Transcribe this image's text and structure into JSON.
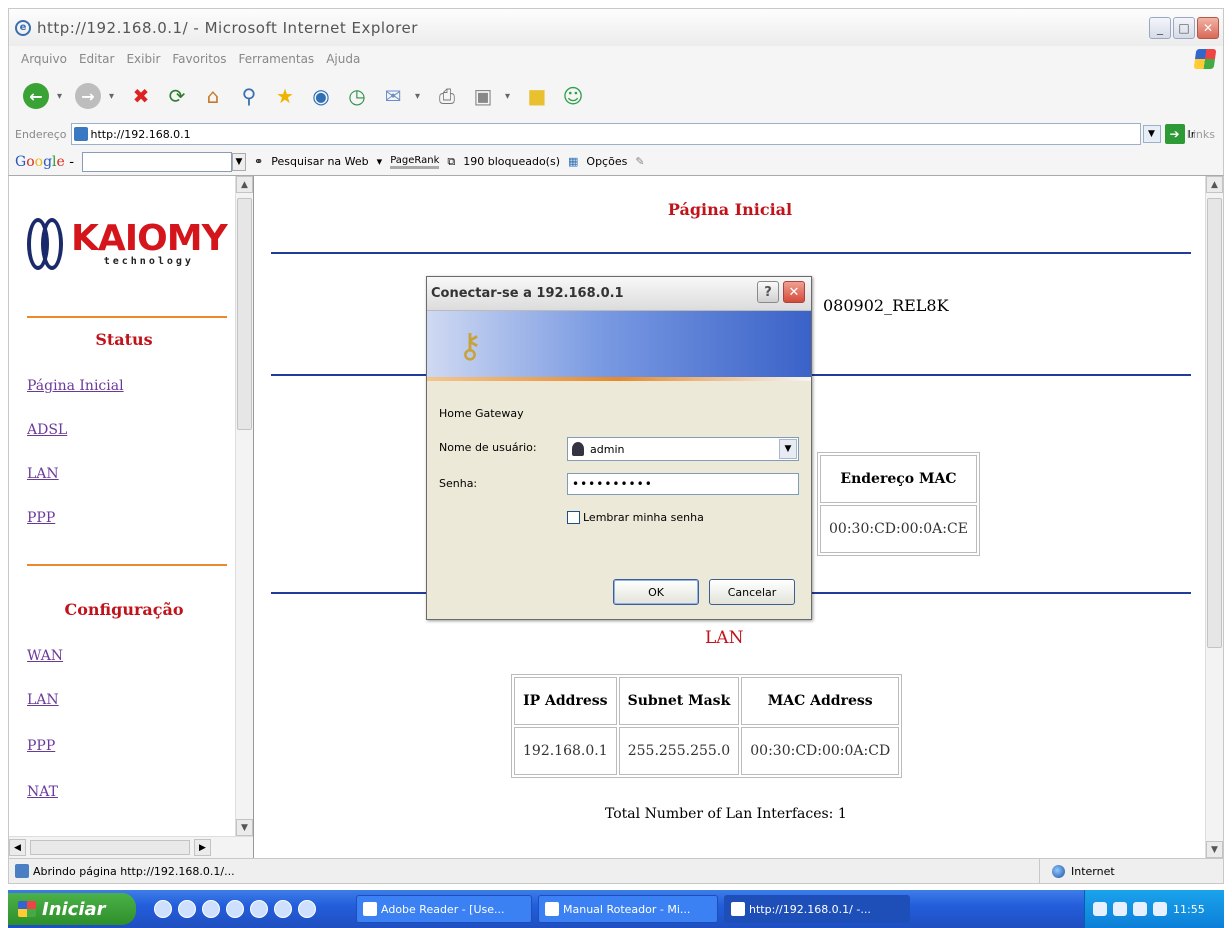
{
  "window": {
    "title": "http://192.168.0.1/ - Microsoft Internet Explorer",
    "minimize_glyph": "_",
    "maximize_glyph": "□",
    "close_glyph": "✕"
  },
  "menu": [
    "Arquivo",
    "Editar",
    "Exibir",
    "Favoritos",
    "Ferramentas",
    "Ajuda"
  ],
  "toolbar": {
    "icons": [
      "back-icon",
      "forward-icon",
      "stop-icon",
      "refresh-icon",
      "home-icon",
      "search-icon",
      "favorites-icon",
      "media-icon",
      "history-icon",
      "mail-icon",
      "print-icon",
      "edit-icon",
      "discuss-icon",
      "messenger-icon"
    ]
  },
  "address": {
    "label": "Endereço",
    "url": "http://192.168.0.1",
    "go_label": "Ir",
    "links_label": "Links"
  },
  "google_bar": {
    "logo": "Google",
    "search_web": "Pesquisar na Web",
    "pagerank": "PageRank",
    "blocked": "190 bloqueado(s)",
    "options": "Opções"
  },
  "sidebar": {
    "logo_main": "KAIOMY",
    "logo_sub": "technology",
    "status_heading": "Status",
    "status_links": [
      "Página Inicial",
      "ADSL",
      "LAN",
      "PPP"
    ],
    "config_heading": "Configuração",
    "config_links": [
      "WAN",
      "LAN",
      "PPP",
      "NAT"
    ]
  },
  "main": {
    "page_title": "Página Inicial",
    "firmware_partial": "080902_REL8K",
    "mac_table": {
      "header": "Endereço MAC",
      "value": "00:30:CD:00:0A:CE"
    },
    "lan_title": "LAN",
    "lan_table": {
      "headers": [
        "IP Address",
        "Subnet Mask",
        "MAC Address"
      ],
      "row": [
        "192.168.0.1",
        "255.255.255.0",
        "00:30:CD:00:0A:CD"
      ]
    },
    "total_interfaces": "Total Number of Lan Interfaces: 1"
  },
  "dialog": {
    "title": "Conectar-se a 192.168.0.1",
    "help_glyph": "?",
    "close_glyph": "✕",
    "realm": "Home Gateway",
    "username_label": "Nome de usuário:",
    "username_value": "admin",
    "password_label": "Senha:",
    "password_value": "••••••••••",
    "remember_label": "Lembrar minha senha",
    "ok_label": "OK",
    "cancel_label": "Cancelar"
  },
  "status_bar": {
    "text": "Abrindo página http://192.168.0.1/...",
    "zone": "Internet"
  },
  "taskbar": {
    "start_label": "Iniciar",
    "tasks": [
      "Adobe Reader - [Use...",
      "Manual Roteador - Mi...",
      "http://192.168.0.1/ -..."
    ],
    "clock": "11:55"
  }
}
